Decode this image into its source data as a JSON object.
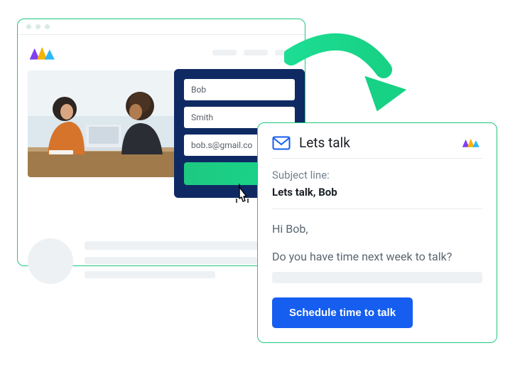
{
  "diagram": {
    "flow": "form-to-email"
  },
  "browser": {
    "form": {
      "first_name": "Bob",
      "last_name": "Smith",
      "email": "bob.s@gmail.co"
    }
  },
  "email": {
    "title": "Lets talk",
    "subject_label": "Subject line:",
    "subject_value": "Lets talk, Bob",
    "greeting": "Hi Bob,",
    "body": "Do you have time next week to talk?",
    "cta_label": "Schedule time to talk"
  },
  "colors": {
    "accent_green": "#1fc77c",
    "form_bg": "#0f2a63",
    "cta_blue": "#155eef"
  }
}
